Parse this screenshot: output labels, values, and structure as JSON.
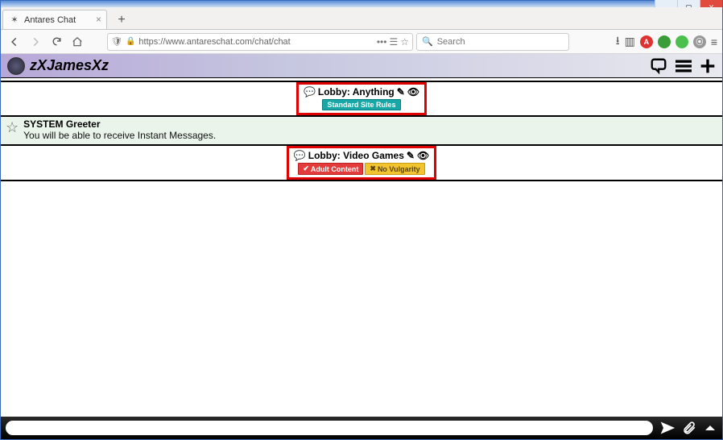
{
  "window": {
    "min_tip": "Minimize",
    "max_tip": "Maximize",
    "close_tip": "Close"
  },
  "browser": {
    "tab_title": "Antares Chat",
    "url": "https://www.antareschat.com/chat/chat",
    "search_placeholder": "Search"
  },
  "header": {
    "username": "zXJamesXz"
  },
  "lobbies": [
    {
      "title": "Lobby: Anything",
      "tags": [
        {
          "style": "teal",
          "icon": "",
          "text": "Standard Site Rules"
        }
      ]
    },
    {
      "title": "Lobby: Video Games",
      "tags": [
        {
          "style": "red",
          "icon": "✔",
          "text": "Adult Content"
        },
        {
          "style": "yel",
          "icon": "✖",
          "text": "No Vulgarity"
        }
      ]
    }
  ],
  "system_message": {
    "sender": "SYSTEM Greeter",
    "body": "You will be able to receive Instant Messages."
  },
  "composer": {
    "placeholder": ""
  }
}
